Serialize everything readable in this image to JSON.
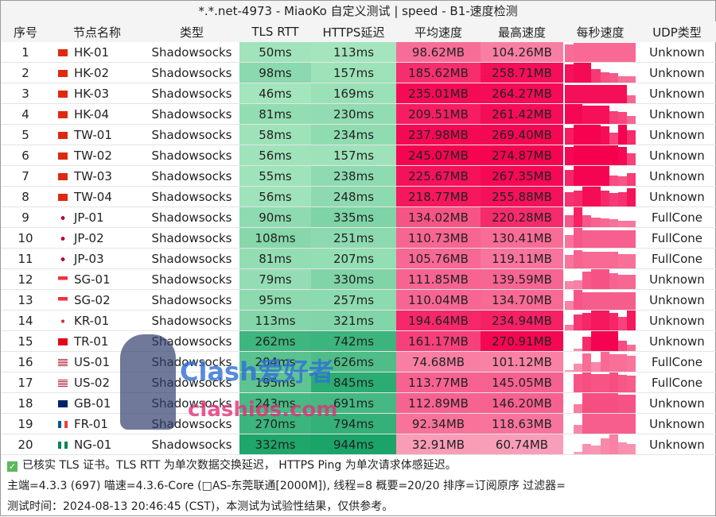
{
  "title": "*.*.net-4973 - MiaoKo 自定义测试 | speed - B1-速度检测",
  "headers": [
    "序号",
    "节点名称",
    "类型",
    "TLS RTT",
    "HTTPS延迟",
    "平均速度",
    "最高速度",
    "每秒速度",
    "UDP类型"
  ],
  "colors": {
    "green_light": "#a6e6bf",
    "green_dark": "#12a063",
    "red_light": "#f9a6bd",
    "red_dark": "#f5004e"
  },
  "rows": [
    {
      "id": "1",
      "flag": "HK",
      "name": "HK-01",
      "type": "Shadowsocks",
      "tls": "50ms",
      "https": "113ms",
      "avg": "98.62MB",
      "max": "104.26MB",
      "udp": "Unknown",
      "spark": [
        0.9,
        0.95,
        0.95,
        0.95,
        0.95,
        0.95,
        0.95,
        0.95
      ]
    },
    {
      "id": "2",
      "flag": "HK",
      "name": "HK-02",
      "type": "Shadowsocks",
      "tls": "98ms",
      "https": "157ms",
      "avg": "185.62MB",
      "max": "258.71MB",
      "udp": "Unknown",
      "spark": [
        0.95,
        1,
        1,
        0.7,
        0.55,
        0.5,
        0.35,
        0.35
      ]
    },
    {
      "id": "3",
      "flag": "HK",
      "name": "HK-03",
      "type": "Shadowsocks",
      "tls": "46ms",
      "https": "169ms",
      "avg": "235.01MB",
      "max": "264.27MB",
      "udp": "Unknown",
      "spark": [
        0.95,
        0.95,
        0.95,
        0.95,
        0.95,
        0.95,
        0.95,
        0.4
      ]
    },
    {
      "id": "4",
      "flag": "HK",
      "name": "HK-04",
      "type": "Shadowsocks",
      "tls": "81ms",
      "https": "230ms",
      "avg": "209.51MB",
      "max": "261.42MB",
      "udp": "Unknown",
      "spark": [
        1,
        1,
        0.95,
        0.95,
        0.95,
        0.65,
        0.6,
        0.4
      ]
    },
    {
      "id": "5",
      "flag": "CN",
      "name": "TW-01",
      "type": "Shadowsocks",
      "tls": "58ms",
      "https": "234ms",
      "avg": "237.98MB",
      "max": "269.40MB",
      "udp": "Unknown",
      "spark": [
        0.85,
        1,
        1,
        1,
        0.95,
        0.6,
        1,
        0.75
      ]
    },
    {
      "id": "6",
      "flag": "CN",
      "name": "TW-02",
      "type": "Shadowsocks",
      "tls": "56ms",
      "https": "157ms",
      "avg": "245.07MB",
      "max": "274.87MB",
      "udp": "Unknown",
      "spark": [
        0.95,
        1,
        1,
        1,
        1,
        1,
        0.95,
        0.6
      ]
    },
    {
      "id": "7",
      "flag": "CN",
      "name": "TW-03",
      "type": "Shadowsocks",
      "tls": "55ms",
      "https": "238ms",
      "avg": "225.67MB",
      "max": "267.35MB",
      "udp": "Unknown",
      "spark": [
        0.8,
        1,
        1,
        1,
        1,
        0.55,
        0.5,
        0.65
      ]
    },
    {
      "id": "8",
      "flag": "CN",
      "name": "TW-04",
      "type": "Shadowsocks",
      "tls": "56ms",
      "https": "248ms",
      "avg": "218.77MB",
      "max": "255.88MB",
      "udp": "Unknown",
      "spark": [
        0.75,
        0.8,
        1,
        1,
        0.8,
        0.7,
        0.75,
        0.95
      ]
    },
    {
      "id": "9",
      "flag": "JP",
      "name": "JP-01",
      "type": "Shadowsocks",
      "tls": "90ms",
      "https": "335ms",
      "avg": "134.02MB",
      "max": "220.28MB",
      "udp": "FullCone",
      "spark": [
        0.6,
        1,
        0.6,
        0.5,
        0.45,
        0.4,
        0.35,
        0.35
      ]
    },
    {
      "id": "10",
      "flag": "JP",
      "name": "JP-02",
      "type": "Shadowsocks",
      "tls": "108ms",
      "https": "251ms",
      "avg": "110.73MB",
      "max": "130.41MB",
      "udp": "FullCone",
      "spark": [
        0.65,
        1,
        0.9,
        0.9,
        0.9,
        0.9,
        0.9,
        0.9
      ]
    },
    {
      "id": "11",
      "flag": "JP",
      "name": "JP-03",
      "type": "Shadowsocks",
      "tls": "81ms",
      "https": "207ms",
      "avg": "105.76MB",
      "max": "119.11MB",
      "udp": "FullCone",
      "spark": [
        0.7,
        0.95,
        0.85,
        0.85,
        0.85,
        0.85,
        0.75,
        0.75
      ]
    },
    {
      "id": "12",
      "flag": "SG",
      "name": "SG-01",
      "type": "Shadowsocks",
      "tls": "79ms",
      "https": "330ms",
      "avg": "111.85MB",
      "max": "139.59MB",
      "udp": "Unknown",
      "spark": [
        0.4,
        0.45,
        0.9,
        1,
        1,
        0.8,
        0.75,
        0.75
      ]
    },
    {
      "id": "13",
      "flag": "SG",
      "name": "SG-02",
      "type": "Shadowsocks",
      "tls": "95ms",
      "https": "257ms",
      "avg": "110.04MB",
      "max": "134.70MB",
      "udp": "Unknown",
      "spark": [
        0.45,
        1,
        0.9,
        0.9,
        0.9,
        0.9,
        0.9,
        0.9
      ]
    },
    {
      "id": "14",
      "flag": "KR",
      "name": "KR-01",
      "type": "Shadowsocks",
      "tls": "113ms",
      "https": "321ms",
      "avg": "194.64MB",
      "max": "234.94MB",
      "udp": "Unknown",
      "spark": [
        0.3,
        0.8,
        0.9,
        1,
        1,
        0.9,
        0.7,
        1
      ]
    },
    {
      "id": "15",
      "flag": "TR",
      "name": "TR-01",
      "type": "Shadowsocks",
      "tls": "262ms",
      "https": "742ms",
      "avg": "161.17MB",
      "max": "270.91MB",
      "udp": "Unknown",
      "spark": [
        0,
        0.15,
        0.75,
        1,
        1,
        1,
        0.55,
        0.35
      ]
    },
    {
      "id": "16",
      "flag": "US",
      "name": "US-01",
      "type": "Shadowsocks",
      "tls": "204ms",
      "https": "626ms",
      "avg": "74.68MB",
      "max": "101.12MB",
      "udp": "FullCone",
      "spark": [
        0.1,
        0.4,
        0.95,
        0.5,
        1,
        0.9,
        0.9,
        0.8
      ]
    },
    {
      "id": "17",
      "flag": "US",
      "name": "US-02",
      "type": "Shadowsocks",
      "tls": "195ms",
      "https": "845ms",
      "avg": "113.77MB",
      "max": "145.05MB",
      "udp": "FullCone",
      "spark": [
        0,
        0.95,
        1,
        0.95,
        0.95,
        1,
        0.9,
        0.85
      ]
    },
    {
      "id": "18",
      "flag": "GB",
      "name": "GB-01",
      "type": "Shadowsocks",
      "tls": "243ms",
      "https": "691ms",
      "avg": "112.89MB",
      "max": "146.20MB",
      "udp": "Unknown",
      "spark": [
        0,
        0.45,
        1,
        1,
        1,
        1,
        0.95,
        0.95
      ]
    },
    {
      "id": "19",
      "flag": "FR",
      "name": "FR-01",
      "type": "Shadowsocks",
      "tls": "270ms",
      "https": "794ms",
      "avg": "92.34MB",
      "max": "118.63MB",
      "udp": "Unknown",
      "spark": [
        0,
        0.45,
        1,
        1,
        1,
        1,
        1,
        1
      ]
    },
    {
      "id": "20",
      "flag": "NG",
      "name": "NG-01",
      "type": "Shadowsocks",
      "tls": "332ms",
      "https": "944ms",
      "avg": "32.91MB",
      "max": "60.74MB",
      "udp": "Unknown",
      "spark": [
        0,
        0.15,
        0.55,
        0.45,
        0.8,
        1,
        0.6,
        0.55
      ]
    }
  ],
  "footer": {
    "line1": "已核实 TLS 证书。TLS RTT 为单次数据交换延迟， HTTPS Ping 为单次请求体感延迟。",
    "line2": "主端=4.3.3 (697) 喵速=4.3.6-Core (□AS-东莞联通[2000M]), 线程=8 概要=20/20 排序=订阅原序 过滤器=",
    "line3": "测试时间：2024-08-13 20:46:45 (CST)，本测试为试验性结果，仅供参考。"
  },
  "watermark": {
    "text1": "Clash爱好者",
    "text2": "clashios.com"
  }
}
